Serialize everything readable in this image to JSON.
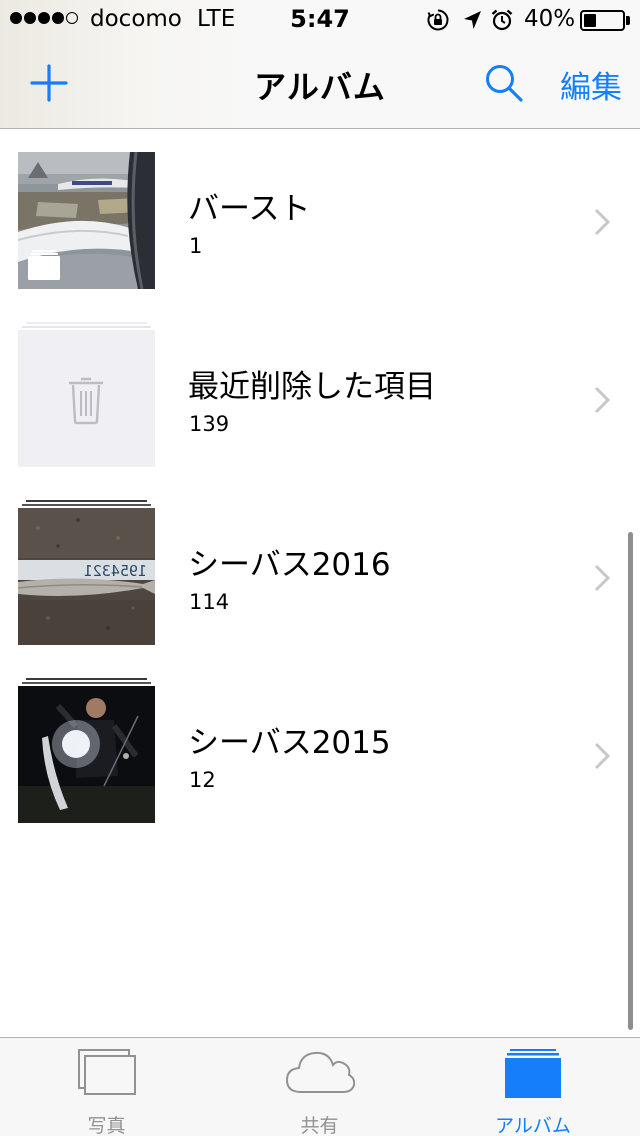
{
  "status_bar": {
    "signal_dots": 5,
    "signal_filled": 4,
    "carrier": "docomo",
    "network": "LTE",
    "time": "5:47",
    "icons": [
      "orientation-lock-icon",
      "location-arrow-icon",
      "alarm-icon"
    ],
    "battery_percent": 40,
    "battery_label": "40%"
  },
  "nav": {
    "add_icon": "plus-icon",
    "title": "アルバム",
    "search_icon": "search-icon",
    "edit_label": "編集"
  },
  "albums": [
    {
      "name": "バースト",
      "count": "1",
      "thumbnail": "photo-airport",
      "badge_icon": "burst-stack-icon"
    },
    {
      "name": "最近削除した項目",
      "count": "139",
      "thumbnail": "trash-placeholder",
      "badge_icon": "trash-icon"
    },
    {
      "name": "シーバス2016",
      "count": "114",
      "thumbnail": "photo-fish-measure"
    },
    {
      "name": "シーバス2015",
      "count": "12",
      "thumbnail": "photo-night-fishing"
    }
  ],
  "tabs": [
    {
      "label": "写真",
      "icon": "photos-stack-icon",
      "active": false
    },
    {
      "label": "共有",
      "icon": "cloud-icon",
      "active": false
    },
    {
      "label": "アルバム",
      "icon": "albums-icon",
      "active": true
    }
  ],
  "colors": {
    "accent": "#147efb",
    "inactive_tab": "#929292",
    "chevron": "#c7c7cc",
    "divider": "#b2b2b2"
  }
}
